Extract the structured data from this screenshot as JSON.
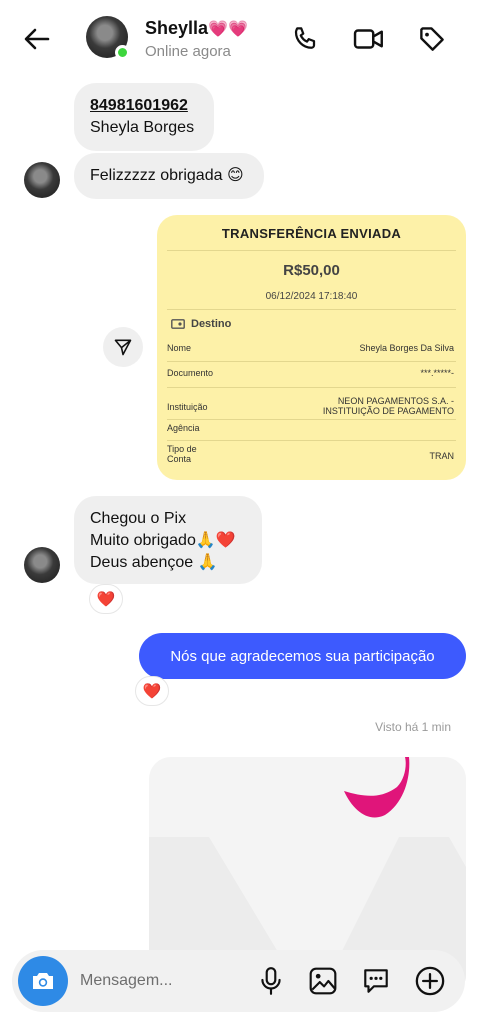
{
  "header": {
    "contact_name": "Sheylla",
    "name_hearts": "💗💗",
    "status": "Online agora",
    "icons": [
      "back-arrow-icon",
      "phone-icon",
      "video-camera-icon",
      "tag-icon"
    ]
  },
  "messages": {
    "contact_msg1_line1": "84981601962",
    "contact_msg1_line2": "Sheyla Borges",
    "contact_msg2": "Felizzzzz obrigada 😊",
    "contact_msg3_line1": "Chegou o Pix",
    "contact_msg3_line2": "Muito obrigado🙏❤️",
    "contact_msg3_line3": "Deus abençoe 🙏",
    "reaction_heart": "❤️",
    "outgoing_msg": "Nós que agradecemos sua participação",
    "seen_status": "Visto há 1 min"
  },
  "receipt": {
    "title": "TRANSFERÊNCIA ENVIADA",
    "amount": "R$50,00",
    "datetime": "06/12/2024 17:18:40",
    "destino_label": "Destino",
    "rows": [
      {
        "label": "Nome",
        "value": "Sheyla Borges Da Silva"
      },
      {
        "label": "Documento",
        "value": "***.*****-"
      },
      {
        "label": "Instituição",
        "value_line1": "NEON PAGAMENTOS S.A. -",
        "value_line2": "INSTITUIÇÃO DE PAGAMENTO"
      },
      {
        "label": "Agência",
        "value": ""
      },
      {
        "label_line1": "Tipo de",
        "label_line2": "Conta",
        "value": "TRAN"
      }
    ]
  },
  "composer": {
    "placeholder": "Mensagem...",
    "icons": [
      "camera-icon",
      "microphone-icon",
      "gallery-icon",
      "sticker-chat-icon",
      "add-icon"
    ]
  },
  "colors": {
    "accent_blue": "#3d5afe",
    "camera_blue": "#2e8ae6",
    "receipt_yellow": "#fdf1a8",
    "incoming_bubble": "#efefef",
    "online_green": "#3dd63d",
    "heart_red": "#e0282e",
    "sticker_magenta": "#e0157a"
  }
}
